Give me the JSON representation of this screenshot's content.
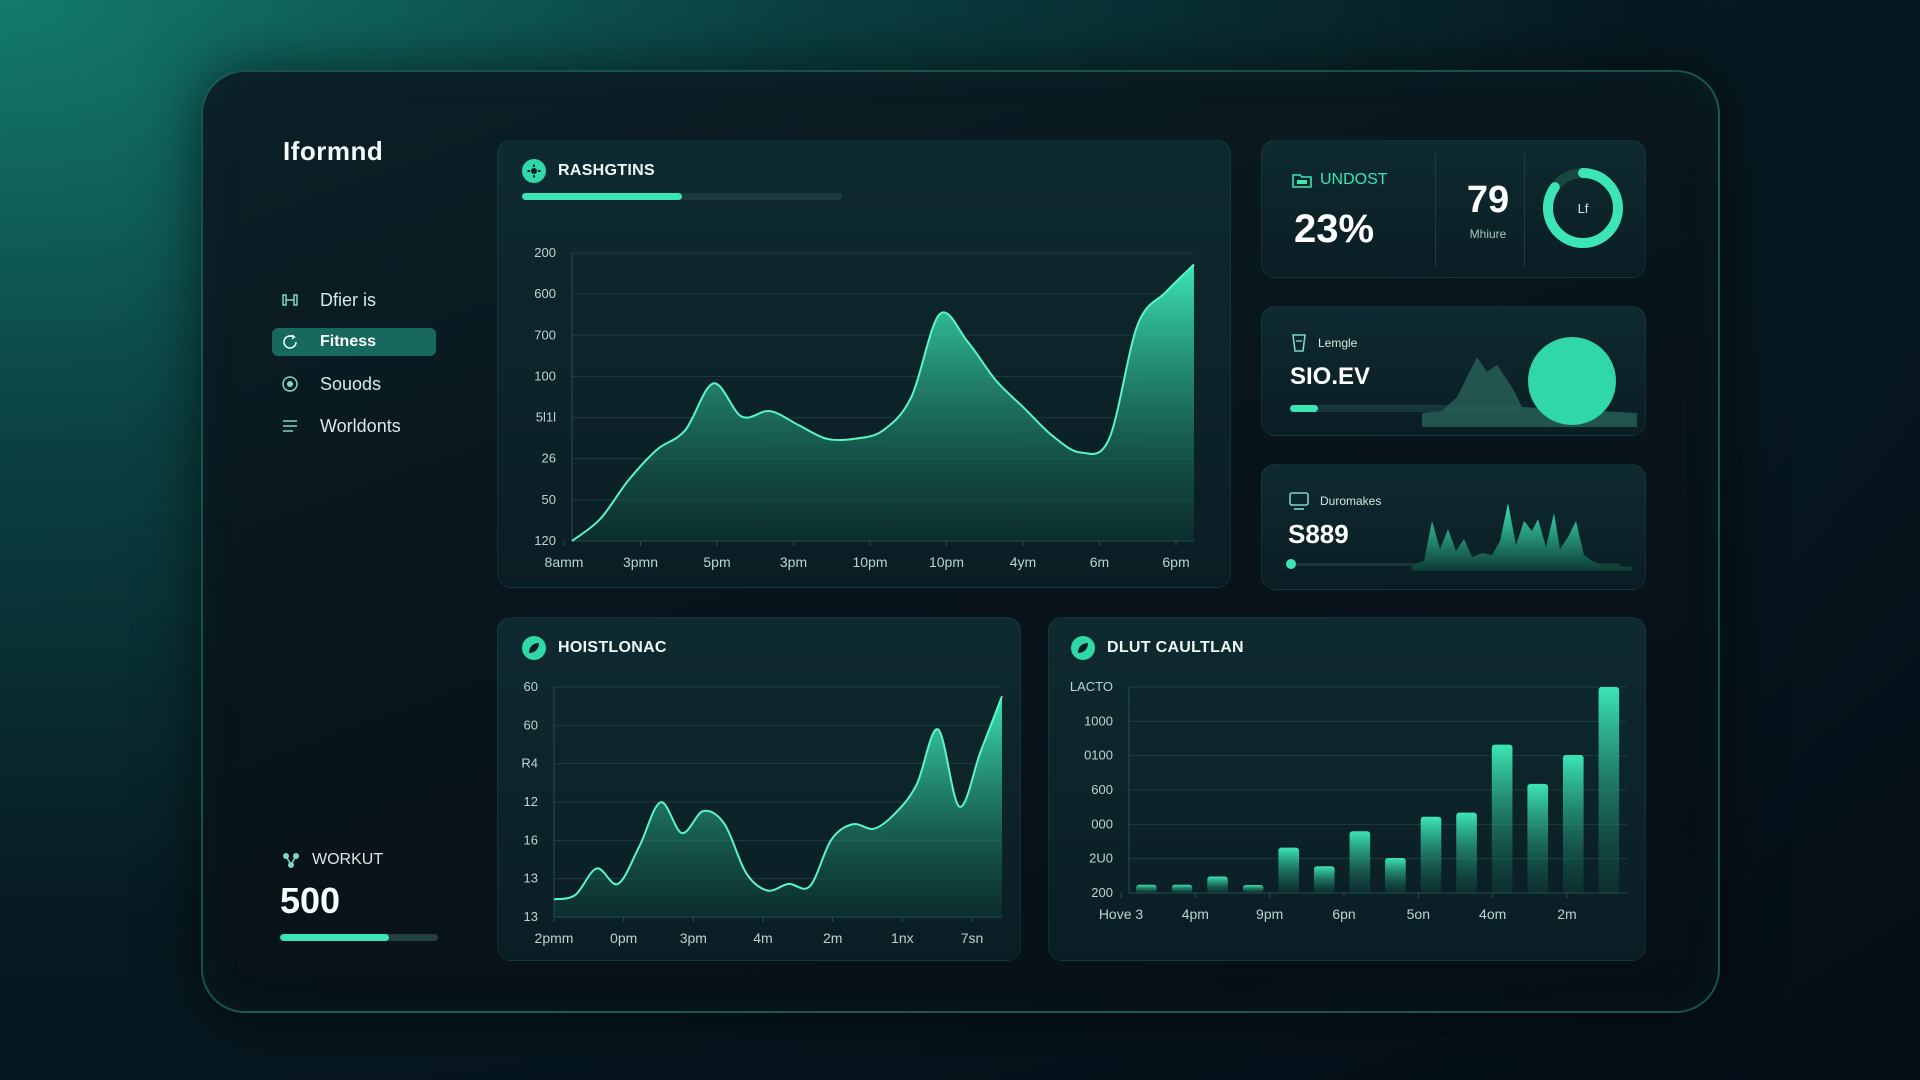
{
  "app": {
    "brand": "Iformnd"
  },
  "colors": {
    "accent": "#3ce6b4",
    "accent_dark": "#17695d",
    "panel": "#0e2a30",
    "background": "#071a22"
  },
  "sidebar": {
    "items": [
      {
        "label": "Dfier is",
        "icon": "dumbbell-icon",
        "active": false
      },
      {
        "label": "Fitness",
        "icon": "circle-arrow-icon",
        "active": true
      },
      {
        "label": "Souods",
        "icon": "clock-icon",
        "active": false
      },
      {
        "label": "Worldonts",
        "icon": "list-icon",
        "active": false
      }
    ],
    "workout": {
      "label": "WORKUT",
      "value": "500",
      "progress": 0.69,
      "icon": "molecule-icon"
    }
  },
  "main_chart": {
    "title": "RASHGTINS",
    "title_icon": "gear-icon",
    "header_progress": 0.5
  },
  "stats": {
    "undost": {
      "label": "UNDOST",
      "value": "23%",
      "icon": "folder-icon"
    },
    "mhiure": {
      "value": "79",
      "label": "Mhiure"
    },
    "ring": {
      "label": "Lf",
      "progress": 0.85
    },
    "lemgle": {
      "label": "Lemgle",
      "value": "SIO.EV",
      "icon": "cup-icon",
      "progress": 0.12
    },
    "duromakes": {
      "label": "Duromakes",
      "value": "S889",
      "icon": "monitor-icon",
      "progress": 0.02
    }
  },
  "hoist_chart": {
    "title": "HOISTLONAC",
    "title_icon": "leaf-icon"
  },
  "dlut_chart": {
    "title": "DLUT CAULTLAN",
    "title_icon": "leaf-icon"
  },
  "chart_data": [
    {
      "type": "area",
      "title": "RASHGTINS",
      "y_ticks": [
        "200",
        "600",
        "700",
        "100",
        "5l1l",
        "26",
        "50",
        "120"
      ],
      "x_ticks": [
        "8amm",
        "3pmn",
        "5pm",
        "3pm",
        "10pm",
        "10pm",
        "4ym",
        "6m",
        "6pm"
      ],
      "values": [
        0,
        8,
        22,
        33,
        40,
        57,
        45,
        47,
        42,
        37,
        37,
        40,
        52,
        82,
        72,
        58,
        48,
        38,
        32,
        37,
        78,
        90,
        100
      ],
      "grid": true
    },
    {
      "type": "area",
      "title": "HOISTLONAC",
      "y_ticks": [
        "60",
        "60",
        "R4",
        "12",
        "16",
        "13",
        "13"
      ],
      "x_ticks": [
        "2pmm",
        "0pm",
        "3pm",
        "4m",
        "2m",
        "1nx",
        "7sn"
      ],
      "values": [
        8,
        10,
        22,
        15,
        32,
        52,
        38,
        48,
        42,
        20,
        12,
        15,
        14,
        35,
        42,
        40,
        47,
        60,
        85,
        50,
        75,
        100
      ],
      "grid": true
    },
    {
      "type": "bar",
      "title": "DLUT CAULTLAN",
      "y_ticks": [
        "LACTO",
        "1000",
        "0100",
        "600",
        "000",
        "2U0",
        "200"
      ],
      "x_ticks": [
        "Hove 3",
        "4pm",
        "9pm",
        "6pn",
        "5on",
        "4om",
        "2m"
      ],
      "values": [
        4,
        4,
        8,
        3,
        22,
        13,
        30,
        17,
        37,
        39,
        72,
        53,
        67,
        100
      ],
      "grid": true
    }
  ]
}
